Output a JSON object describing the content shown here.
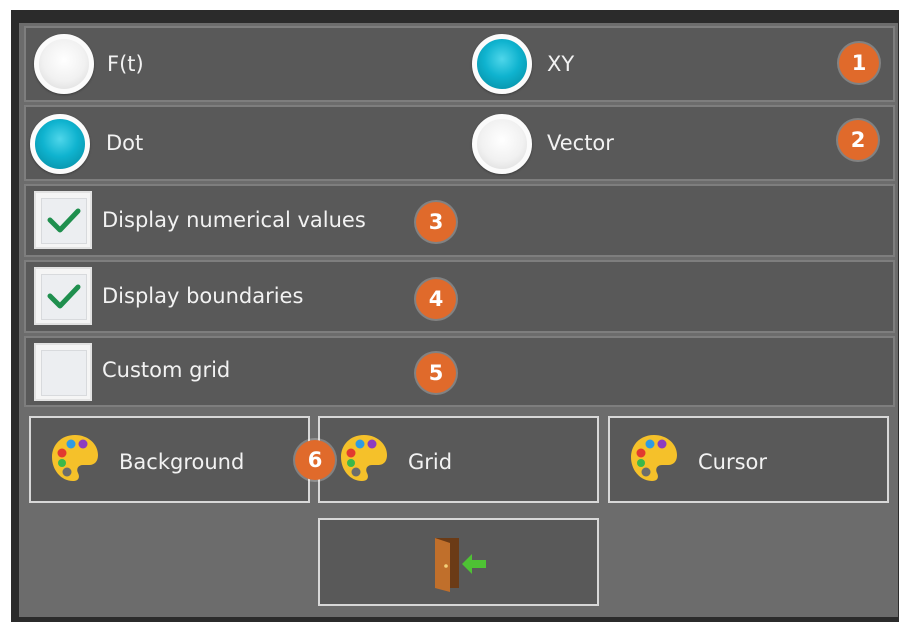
{
  "options": {
    "mode_row": {
      "ft_label": "F(t)",
      "xy_label": "XY",
      "selected": "XY",
      "badge": "1"
    },
    "style_row": {
      "dot_label": "Dot",
      "vector_label": "Vector",
      "selected": "Dot",
      "badge": "2"
    },
    "display_numerical": {
      "label": "Display numerical values",
      "checked": true,
      "badge": "3"
    },
    "display_boundaries": {
      "label": "Display boundaries",
      "checked": true,
      "badge": "4"
    },
    "custom_grid": {
      "label": "Custom grid",
      "checked": false,
      "badge": "5"
    }
  },
  "color_buttons": {
    "background_label": "Background",
    "grid_label": "Grid",
    "cursor_label": "Cursor",
    "badge": "6",
    "icon": "palette-icon"
  },
  "exit_button": {
    "icon": "exit-door-icon"
  },
  "colors": {
    "accent_badge": "#e06a2b",
    "radio_selected": "#0fb3cf",
    "checkmark": "#1f8f4e",
    "panel_bg": "#6c6c6c",
    "row_bg": "#595959"
  }
}
